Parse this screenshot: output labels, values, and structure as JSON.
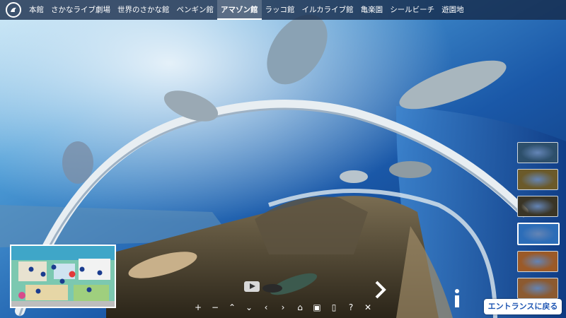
{
  "nav": {
    "items": [
      {
        "label": "本館",
        "name": "nav-item-honkan"
      },
      {
        "label": "さかなライブ劇場",
        "name": "nav-item-sakana-live"
      },
      {
        "label": "世界のさかな館",
        "name": "nav-item-world-fish"
      },
      {
        "label": "ペンギン館",
        "name": "nav-item-penguin"
      },
      {
        "label": "アマゾン館",
        "name": "nav-item-amazon",
        "active": true
      },
      {
        "label": "ラッコ館",
        "name": "nav-item-sea-otter"
      },
      {
        "label": "イルカライブ館",
        "name": "nav-item-dolphin-live"
      },
      {
        "label": "亀楽園",
        "name": "nav-item-turtle"
      },
      {
        "label": "シールビーチ",
        "name": "nav-item-seal-beach"
      },
      {
        "label": "遊園地",
        "name": "nav-item-amusement-park"
      }
    ]
  },
  "controls": [
    {
      "glyph": "+",
      "name": "zoom-in-button"
    },
    {
      "glyph": "−",
      "name": "zoom-out-button"
    },
    {
      "glyph": "⌃",
      "name": "pan-up-button"
    },
    {
      "glyph": "⌄",
      "name": "pan-down-button"
    },
    {
      "glyph": "‹",
      "name": "pan-left-button"
    },
    {
      "glyph": "›",
      "name": "pan-right-button"
    },
    {
      "glyph": "⌂",
      "name": "home-icon"
    },
    {
      "glyph": "▣",
      "name": "thumbnails-icon"
    },
    {
      "glyph": "▯",
      "name": "map-icon"
    },
    {
      "glyph": "?",
      "name": "help-icon"
    },
    {
      "glyph": "✕",
      "name": "close-icon"
    }
  ],
  "entrance_button": {
    "label": "エントランスに戻る"
  },
  "thumbnails": [
    {
      "name": "thumbnail-1",
      "color": "#2d4f6b"
    },
    {
      "name": "thumbnail-2",
      "color": "#6b5a2a"
    },
    {
      "name": "thumbnail-3",
      "color": "#3a3526"
    },
    {
      "name": "thumbnail-4",
      "color": "#2c6db8",
      "selected": true
    },
    {
      "name": "thumbnail-5",
      "color": "#9b5a28"
    },
    {
      "name": "thumbnail-6",
      "color": "#8c5a30"
    }
  ],
  "colors": {
    "nav_bg": "#1c3250",
    "accent": "#1f56b3"
  }
}
